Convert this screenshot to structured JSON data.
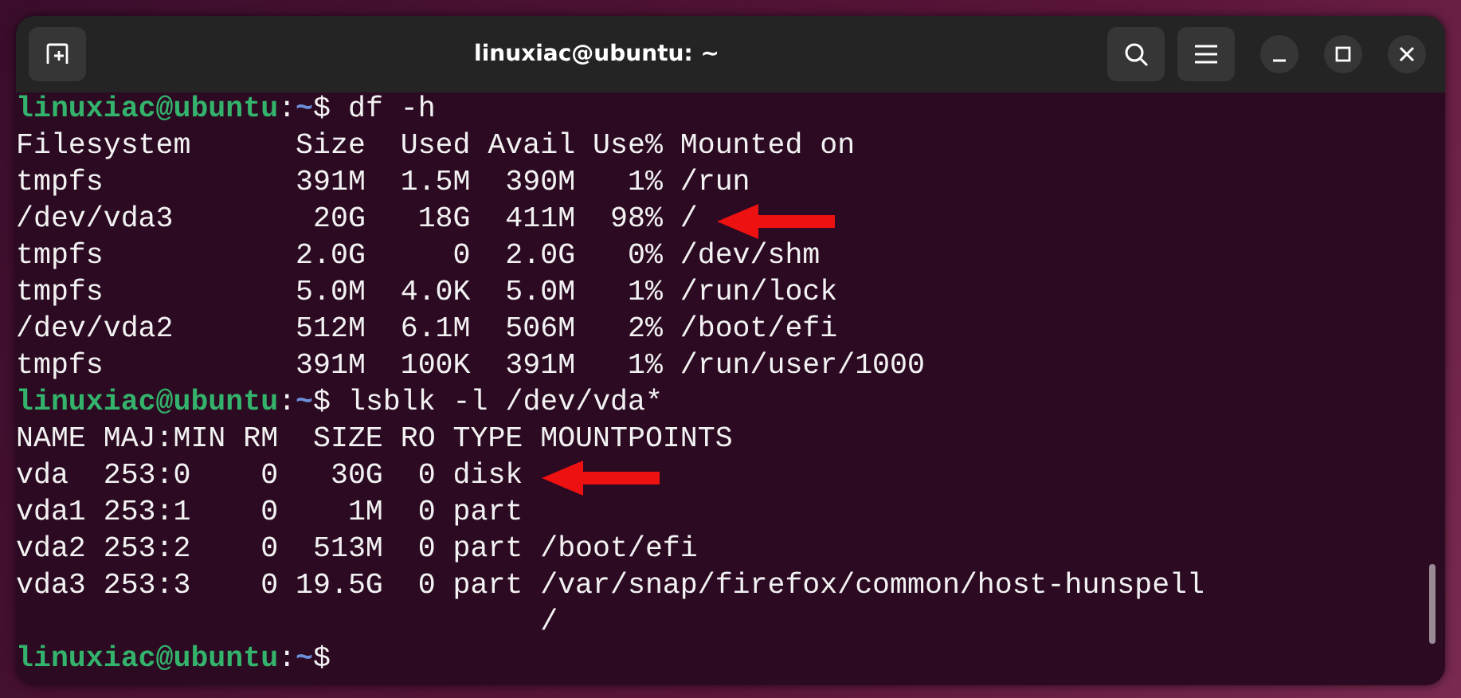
{
  "window": {
    "title": "linuxiac@ubuntu: ~"
  },
  "terminal": {
    "lines": [
      {
        "kind": "prompt",
        "user": "linuxiac@ubuntu",
        "separator": ":",
        "path": "~",
        "symbol": "$",
        "command": "df -h"
      },
      {
        "kind": "output",
        "text": "Filesystem      Size  Used Avail Use% Mounted on"
      },
      {
        "kind": "output",
        "text": "tmpfs           391M  1.5M  390M   1% /run"
      },
      {
        "kind": "output",
        "text": "/dev/vda3        20G   18G  411M  98% /",
        "arrow": true
      },
      {
        "kind": "output",
        "text": "tmpfs           2.0G     0  2.0G   0% /dev/shm"
      },
      {
        "kind": "output",
        "text": "tmpfs           5.0M  4.0K  5.0M   1% /run/lock"
      },
      {
        "kind": "output",
        "text": "/dev/vda2       512M  6.1M  506M   2% /boot/efi"
      },
      {
        "kind": "output",
        "text": "tmpfs           391M  100K  391M   1% /run/user/1000"
      },
      {
        "kind": "prompt",
        "user": "linuxiac@ubuntu",
        "separator": ":",
        "path": "~",
        "symbol": "$",
        "command": "lsblk -l /dev/vda*"
      },
      {
        "kind": "output",
        "text": "NAME MAJ:MIN RM  SIZE RO TYPE MOUNTPOINTS"
      },
      {
        "kind": "output",
        "text": "vda  253:0    0   30G  0 disk",
        "arrow": true
      },
      {
        "kind": "output",
        "text": "vda1 253:1    0    1M  0 part"
      },
      {
        "kind": "output",
        "text": "vda2 253:2    0  513M  0 part /boot/efi"
      },
      {
        "kind": "output",
        "text": "vda3 253:3    0 19.5G  0 part /var/snap/firefox/common/host-hunspell"
      },
      {
        "kind": "output",
        "text": "                              /"
      },
      {
        "kind": "prompt",
        "user": "linuxiac@ubuntu",
        "separator": ":",
        "path": "~",
        "symbol": "$"
      }
    ]
  }
}
